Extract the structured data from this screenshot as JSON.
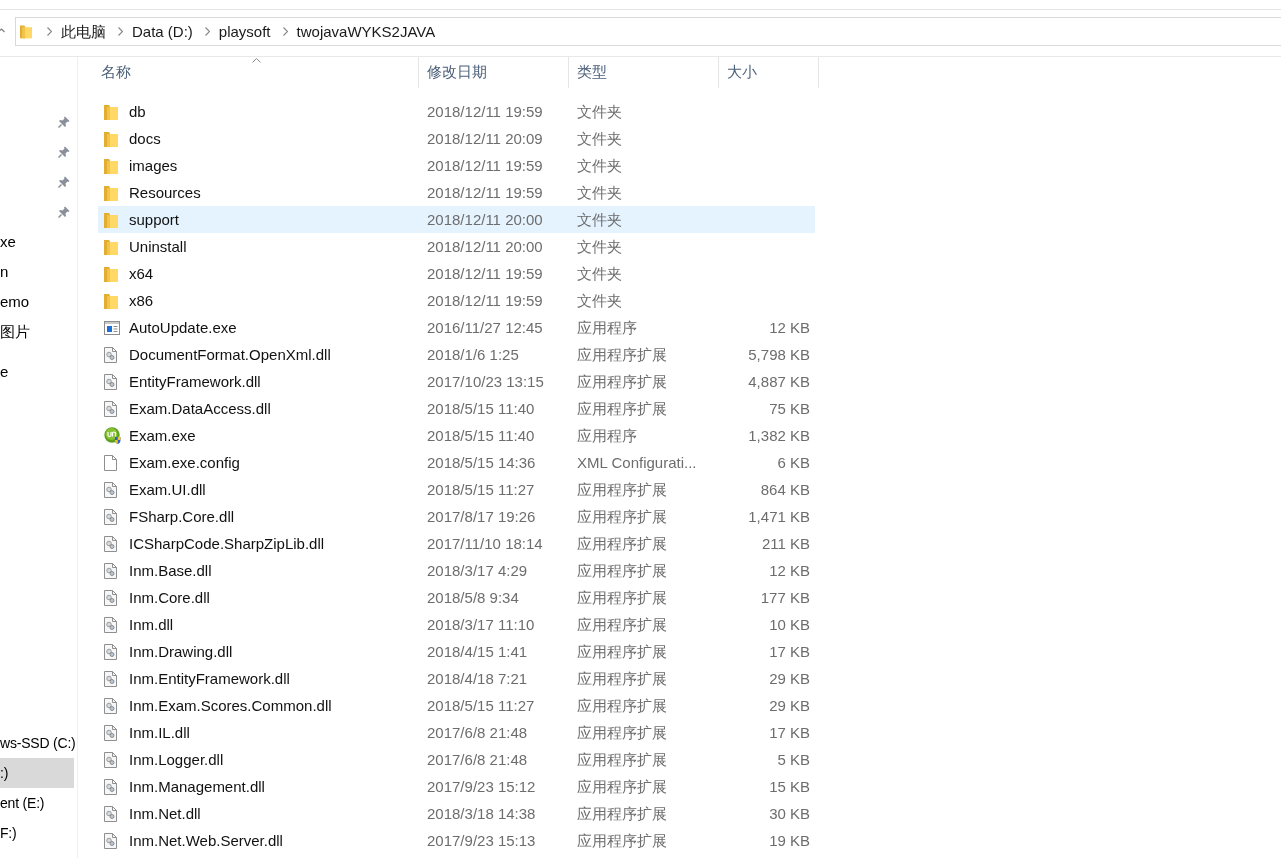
{
  "address_bar": {
    "crumbs": [
      "此电脑",
      "Data (D:)",
      "playsoft",
      "twojavaWYKS2JAVA"
    ]
  },
  "sidebar": {
    "quick_access": [
      {
        "pinned": true
      },
      {
        "pinned": true
      },
      {
        "pinned": true
      },
      {
        "pinned": true
      },
      {
        "label": "xe",
        "pinned": false
      },
      {
        "label": "n",
        "pinned": false
      },
      {
        "label": "emo",
        "pinned": false
      },
      {
        "label": "图片",
        "pinned": false
      }
    ],
    "onedrive": [
      {
        "label": "e"
      }
    ],
    "this_pc": [
      {
        "label": "ws-SSD (C:)",
        "selected": false
      },
      {
        "label": ":)",
        "selected": true
      },
      {
        "label": "ent (E:)",
        "selected": false
      },
      {
        "label": "F:)",
        "selected": false
      }
    ]
  },
  "table": {
    "columns": [
      {
        "label": "名称",
        "sorted": true
      },
      {
        "label": "修改日期",
        "sorted": false
      },
      {
        "label": "类型",
        "sorted": false
      },
      {
        "label": "大小",
        "sorted": false
      }
    ],
    "rows": [
      {
        "kind": "folder",
        "name": "db",
        "modified": "2018/12/11 19:59",
        "type": "文件夹",
        "selected": false
      },
      {
        "kind": "folder",
        "name": "docs",
        "modified": "2018/12/11 20:09",
        "type": "文件夹",
        "selected": false
      },
      {
        "kind": "folder",
        "name": "images",
        "modified": "2018/12/11 19:59",
        "type": "文件夹",
        "selected": false
      },
      {
        "kind": "folder",
        "name": "Resources",
        "modified": "2018/12/11 19:59",
        "type": "文件夹",
        "selected": false
      },
      {
        "kind": "folder",
        "name": "support",
        "modified": "2018/12/11 20:00",
        "type": "文件夹",
        "selected": true
      },
      {
        "kind": "folder",
        "name": "Uninstall",
        "modified": "2018/12/11 20:00",
        "type": "文件夹",
        "selected": false
      },
      {
        "kind": "folder",
        "name": "x64",
        "modified": "2018/12/11 19:59",
        "type": "文件夹",
        "selected": false
      },
      {
        "kind": "folder",
        "name": "x86",
        "modified": "2018/12/11 19:59",
        "type": "文件夹",
        "selected": false
      },
      {
        "kind": "program",
        "name": "AutoUpdate.exe",
        "modified": "2016/11/27 12:45",
        "type": "应用程序",
        "size": "12 KB",
        "selected": false
      },
      {
        "kind": "extension",
        "name": "DocumentFormat.OpenXml.dll",
        "modified": "2018/1/6 1:25",
        "type": "应用程序扩展",
        "size": "5,798 KB",
        "selected": false
      },
      {
        "kind": "extension",
        "name": "EntityFramework.dll",
        "modified": "2017/10/23 13:15",
        "type": "应用程序扩展",
        "size": "4,887 KB",
        "selected": false
      },
      {
        "kind": "extension",
        "name": "Exam.DataAccess.dll",
        "modified": "2018/5/15 11:40",
        "type": "应用程序扩展",
        "size": "75 KB",
        "selected": false
      },
      {
        "kind": "custom",
        "name": "Exam.exe",
        "modified": "2018/5/15 11:40",
        "type": "应用程序",
        "size": "1,382 KB",
        "selected": false
      },
      {
        "kind": "document",
        "name": "Exam.exe.config",
        "modified": "2018/5/15 14:36",
        "type": "XML Configurati...",
        "size": "6 KB",
        "selected": false
      },
      {
        "kind": "extension",
        "name": "Exam.UI.dll",
        "modified": "2018/5/15 11:27",
        "type": "应用程序扩展",
        "size": "864 KB",
        "selected": false
      },
      {
        "kind": "extension",
        "name": "FSharp.Core.dll",
        "modified": "2017/8/17 19:26",
        "type": "应用程序扩展",
        "size": "1,471 KB",
        "selected": false
      },
      {
        "kind": "extension",
        "name": "ICSharpCode.SharpZipLib.dll",
        "modified": "2017/11/10 18:14",
        "type": "应用程序扩展",
        "size": "211 KB",
        "selected": false
      },
      {
        "kind": "extension",
        "name": "Inm.Base.dll",
        "modified": "2018/3/17 4:29",
        "type": "应用程序扩展",
        "size": "12 KB",
        "selected": false
      },
      {
        "kind": "extension",
        "name": "Inm.Core.dll",
        "modified": "2018/5/8 9:34",
        "type": "应用程序扩展",
        "size": "177 KB",
        "selected": false
      },
      {
        "kind": "extension",
        "name": "Inm.dll",
        "modified": "2018/3/17 11:10",
        "type": "应用程序扩展",
        "size": "10 KB",
        "selected": false
      },
      {
        "kind": "extension",
        "name": "Inm.Drawing.dll",
        "modified": "2018/4/15 1:41",
        "type": "应用程序扩展",
        "size": "17 KB",
        "selected": false
      },
      {
        "kind": "extension",
        "name": "Inm.EntityFramework.dll",
        "modified": "2018/4/18 7:21",
        "type": "应用程序扩展",
        "size": "29 KB",
        "selected": false
      },
      {
        "kind": "extension",
        "name": "Inm.Exam.Scores.Common.dll",
        "modified": "2018/5/15 11:27",
        "type": "应用程序扩展",
        "size": "29 KB",
        "selected": false
      },
      {
        "kind": "extension",
        "name": "Inm.IL.dll",
        "modified": "2017/6/8 21:48",
        "type": "应用程序扩展",
        "size": "17 KB",
        "selected": false
      },
      {
        "kind": "extension",
        "name": "Inm.Logger.dll",
        "modified": "2017/6/8 21:48",
        "type": "应用程序扩展",
        "size": "5 KB",
        "selected": false
      },
      {
        "kind": "extension",
        "name": "Inm.Management.dll",
        "modified": "2017/9/23 15:12",
        "type": "应用程序扩展",
        "size": "15 KB",
        "selected": false
      },
      {
        "kind": "extension",
        "name": "Inm.Net.dll",
        "modified": "2018/3/18 14:38",
        "type": "应用程序扩展",
        "size": "30 KB",
        "selected": false
      },
      {
        "kind": "extension",
        "name": "Inm.Net.Web.Server.dll",
        "modified": "2017/9/23 15:13",
        "type": "应用程序扩展",
        "size": "19 KB",
        "selected": false
      }
    ]
  }
}
